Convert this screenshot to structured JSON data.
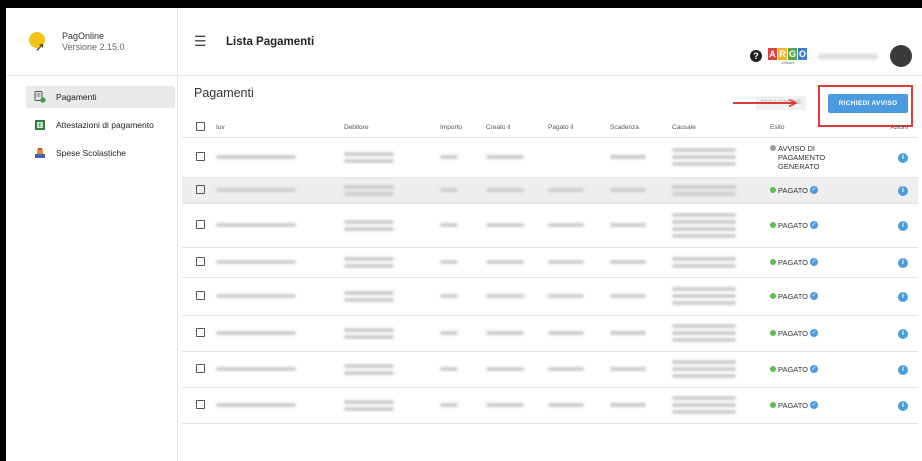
{
  "app": {
    "name": "PagOnline",
    "version": "Versione 2.15.0"
  },
  "sidebar": {
    "items": [
      {
        "label": "Pagamenti",
        "icon": "payment-doc-icon",
        "active": true
      },
      {
        "label": "Attestazioni di pagamento",
        "icon": "receipt-icon"
      },
      {
        "label": "Spese Scolastiche",
        "icon": "school-icon"
      }
    ]
  },
  "header": {
    "title": "Lista Pagamenti",
    "help_icon": "help-icon",
    "argo_letters": [
      "A",
      "R",
      "G",
      "O"
    ],
    "argo_colors": [
      "#e23c3c",
      "#f0b52b",
      "#5aa64a",
      "#3d7fc9"
    ],
    "argo_sub": "software"
  },
  "content": {
    "heading": "Pagamenti",
    "ghost_button": "PAGA ONLINE",
    "primary_button": "RICHIEDI AVVISO",
    "accent_color": "#4a9be0",
    "highlight_color": "#e03a3a"
  },
  "table": {
    "columns": [
      "Iuv",
      "Debitore",
      "Importo",
      "Creato il",
      "Pagato il",
      "Scadenza",
      "Causale",
      "Esito",
      "Azioni"
    ],
    "rows": [
      {
        "esito": "AVVISO DI PAGAMENTO GENERATO",
        "status": "gray",
        "verified": false
      },
      {
        "esito": "PAGATO",
        "status": "green",
        "verified": true
      },
      {
        "esito": "PAGATO",
        "status": "green",
        "verified": true
      },
      {
        "esito": "PAGATO",
        "status": "green",
        "verified": true
      },
      {
        "esito": "PAGATO",
        "status": "green",
        "verified": true
      },
      {
        "esito": "PAGATO",
        "status": "green",
        "verified": true
      },
      {
        "esito": "PAGATO",
        "status": "green",
        "verified": true
      },
      {
        "esito": "PAGATO",
        "status": "green",
        "verified": true
      }
    ]
  }
}
